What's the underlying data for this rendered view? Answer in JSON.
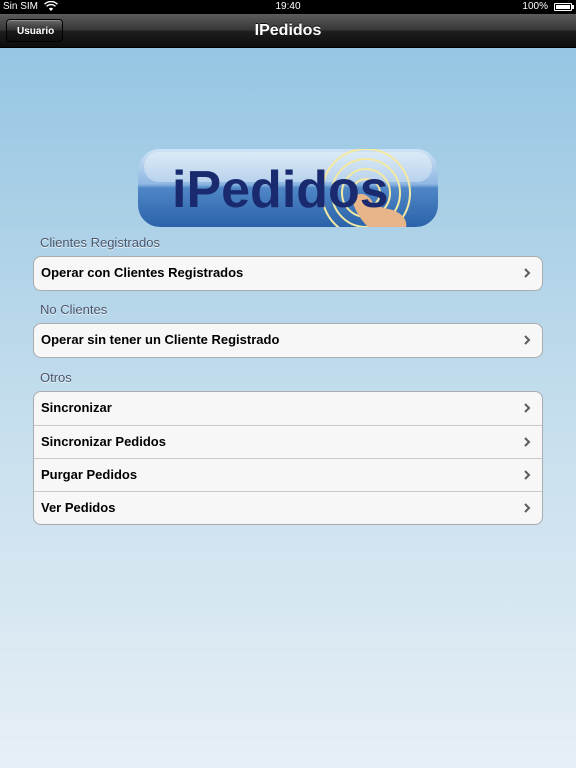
{
  "status_bar": {
    "carrier": "Sin SIM",
    "time": "19:40",
    "battery_percent": "100%",
    "battery_level": 1.0,
    "wifi_icon": "wifi-icon",
    "battery_icon": "battery-icon"
  },
  "nav_bar": {
    "title": "IPedidos",
    "back_label": "Usuario"
  },
  "logo": {
    "text": "iPedidos",
    "colors": {
      "pill": "#3f79bd",
      "text": "#1a2a6e",
      "hand": "#e8b48a"
    }
  },
  "sections": [
    {
      "header": "Clientes Registrados",
      "items": [
        {
          "label": "Operar con Clientes Registrados",
          "icon": "chevron-right-icon"
        }
      ]
    },
    {
      "header": "No Clientes",
      "items": [
        {
          "label": "Operar sin tener un Cliente Registrado",
          "icon": "chevron-right-icon"
        }
      ]
    },
    {
      "header": "Otros",
      "items": [
        {
          "label": "Sincronizar",
          "icon": "chevron-right-icon"
        },
        {
          "label": "Sincronizar Pedidos",
          "icon": "chevron-right-icon"
        },
        {
          "label": "Purgar Pedidos",
          "icon": "chevron-right-icon"
        },
        {
          "label": "Ver Pedidos",
          "icon": "chevron-right-icon"
        }
      ]
    }
  ]
}
